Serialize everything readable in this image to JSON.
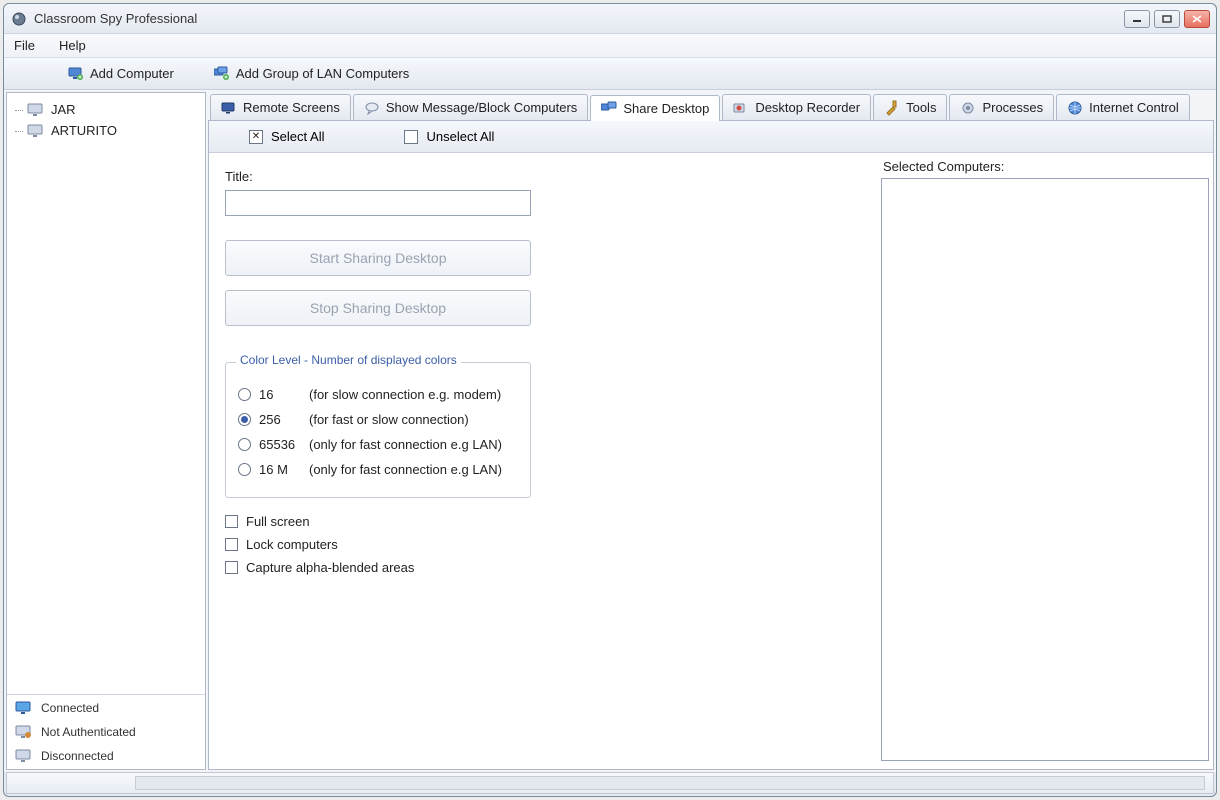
{
  "window": {
    "title": "Classroom Spy Professional"
  },
  "menu": {
    "file": "File",
    "help": "Help"
  },
  "toolbar": {
    "add_computer": "Add Computer",
    "add_group": "Add Group of LAN Computers"
  },
  "sidebar": {
    "items": [
      {
        "label": "JAR"
      },
      {
        "label": "ARTURITO"
      }
    ],
    "legend": {
      "connected": "Connected",
      "not_auth": "Not Authenticated",
      "disconnected": "Disconnected"
    }
  },
  "tabs": {
    "remote_screens": "Remote Screens",
    "show_message": "Show Message/Block Computers",
    "share_desktop": "Share Desktop",
    "desktop_recorder": "Desktop Recorder",
    "tools": "Tools",
    "processes": "Processes",
    "internet_control": "Internet Control"
  },
  "select_bar": {
    "select_all": "Select All",
    "unselect_all": "Unselect All"
  },
  "share": {
    "title_label": "Title:",
    "title_value": "",
    "start_btn": "Start Sharing Desktop",
    "stop_btn": "Stop Sharing Desktop",
    "fieldset_legend": "Color Level - Number of displayed colors",
    "radios": [
      {
        "value": "16",
        "desc": "(for slow connection e.g. modem)",
        "selected": false
      },
      {
        "value": "256",
        "desc": "(for fast or slow connection)",
        "selected": true
      },
      {
        "value": "65536",
        "desc": "(only for fast connection e.g LAN)",
        "selected": false
      },
      {
        "value": "16 M",
        "desc": "(only for fast connection e.g LAN)",
        "selected": false
      }
    ],
    "checks": {
      "full_screen": "Full screen",
      "lock_computers": "Lock computers",
      "capture_alpha": "Capture alpha-blended areas"
    }
  },
  "right_panel": {
    "label": "Selected Computers:"
  }
}
